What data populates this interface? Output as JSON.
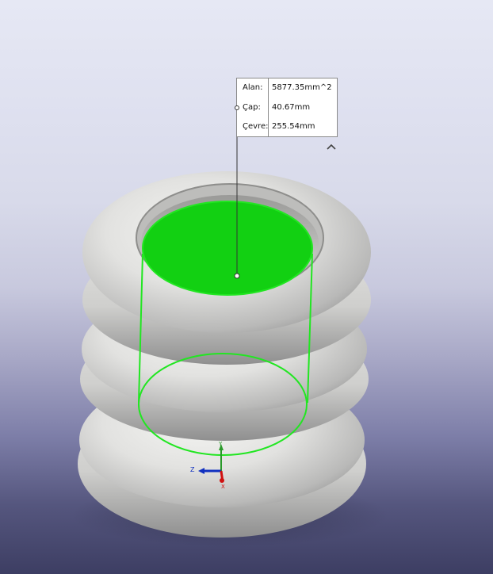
{
  "measure": {
    "rows": [
      {
        "label": "Alan:",
        "value": "5877.35mm^2"
      },
      {
        "label": "Çap:",
        "value": "40.67mm"
      },
      {
        "label": "Çevre:",
        "value": "255.54mm"
      }
    ]
  },
  "triad": {
    "z_label": "Z",
    "y_label": "Y",
    "x_label": "X"
  },
  "colors": {
    "selection": "#12d012",
    "outline": "#22e622"
  },
  "icons": {
    "collapse": "chevron-up-icon"
  }
}
